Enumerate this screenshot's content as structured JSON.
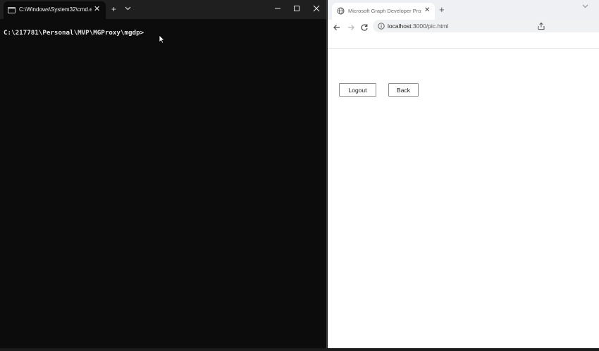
{
  "terminal": {
    "tab_title": "C:\\Windows\\System32\\cmd.e",
    "tab_close": "✕",
    "new_tab": "+",
    "prompt": "C:\\217781\\Personal\\MVP\\MGProxy\\mgdp>"
  },
  "browser": {
    "tab_title": "Microsoft Graph Developer Proxy",
    "tab_close": "✕",
    "new_tab": "+",
    "address": {
      "host": "localhost",
      "rest": ":3000/pic.html"
    },
    "page": {
      "logout_label": "Logout",
      "back_label": "Back"
    }
  },
  "colors": {
    "terminal_bg": "#0c0c0c",
    "terminal_titlebar": "#1f1f1f",
    "browser_tabstrip": "#eef0f3",
    "page_bg": "#ffffff"
  }
}
